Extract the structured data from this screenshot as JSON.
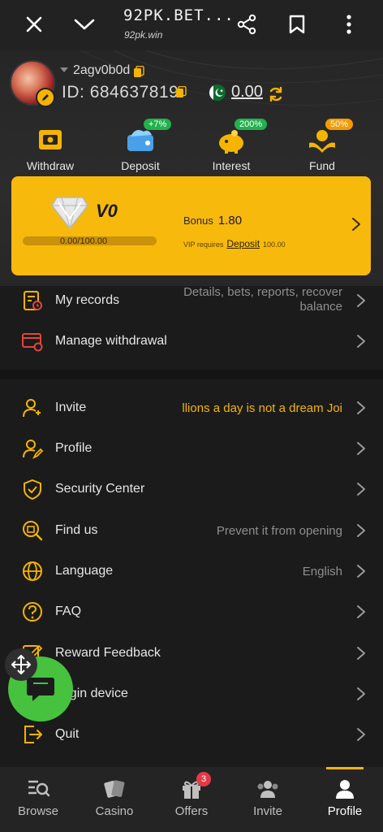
{
  "browser": {
    "title": "92PK.BET...",
    "domain": "92pk.win"
  },
  "account": {
    "username": "2agv0b0d",
    "id_label": "ID:",
    "id_value": "684637819",
    "balance": "0.00"
  },
  "quick_actions": [
    {
      "label": "Withdraw",
      "icon": "withdraw-icon",
      "badge": ""
    },
    {
      "label": "Deposit",
      "icon": "deposit-icon",
      "badge": "+7%"
    },
    {
      "label": "Interest",
      "icon": "piggy-bank-icon",
      "badge": "200%"
    },
    {
      "label": "Fund",
      "icon": "fund-icon",
      "badge": "50%"
    }
  ],
  "vip": {
    "level": "V0",
    "progress_text": "0.00/100.00",
    "progress_fraction": 0,
    "bonus_label": "Bonus",
    "bonus_value": "1.80",
    "requires_label": "VIP requires",
    "requires_link": "Deposit",
    "requires_value": "100.00"
  },
  "menu_top": [
    {
      "label": "My records",
      "value": "Details, bets, reports, recover balance",
      "icon": "records-icon"
    },
    {
      "label": "Manage withdrawal",
      "value": "",
      "icon": "manage-withdrawal-icon"
    }
  ],
  "menu_main": [
    {
      "label": "Invite",
      "value": "llions a day is not a dream  Joi",
      "icon": "invite-icon"
    },
    {
      "label": "Profile",
      "value": "",
      "icon": "profile-icon"
    },
    {
      "label": "Security Center",
      "value": "",
      "icon": "shield-icon"
    },
    {
      "label": "Find us",
      "value": "Prevent it from opening",
      "icon": "find-us-icon"
    },
    {
      "label": "Language",
      "value": "English",
      "icon": "globe-icon"
    },
    {
      "label": "FAQ",
      "value": "",
      "icon": "question-icon"
    },
    {
      "label": "Reward Feedback",
      "value": "",
      "icon": "edit-icon"
    },
    {
      "label": "Login device",
      "value": "",
      "icon": "device-icon"
    },
    {
      "label": "Quit",
      "value": "",
      "icon": "logout-icon"
    }
  ],
  "bottom_nav": [
    {
      "label": "Browse",
      "icon": "browse-icon",
      "badge": ""
    },
    {
      "label": "Casino",
      "icon": "cards-icon",
      "badge": ""
    },
    {
      "label": "Offers",
      "icon": "gift-icon",
      "badge": "3"
    },
    {
      "label": "Invite",
      "icon": "users-icon",
      "badge": ""
    },
    {
      "label": "Profile",
      "icon": "user-icon",
      "badge": ""
    }
  ],
  "colors": {
    "accent": "#f7b90c",
    "background": "#1b1b1b",
    "chat": "#46c23e",
    "badge_green": "#22b14c",
    "badge_red": "#e53946"
  }
}
